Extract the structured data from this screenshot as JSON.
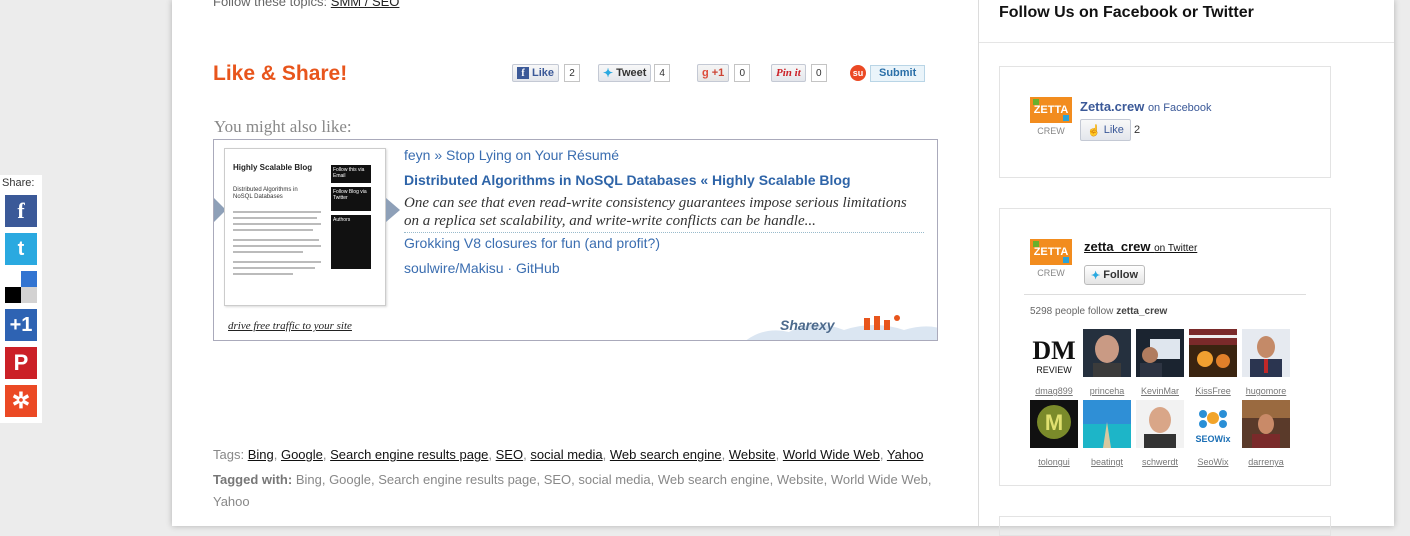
{
  "share_bar": {
    "label": "Share:",
    "buttons": [
      {
        "name": "facebook",
        "glyph": "f"
      },
      {
        "name": "twitter",
        "glyph": "t"
      },
      {
        "name": "delicious",
        "glyph": ""
      },
      {
        "name": "google-plus",
        "glyph": "+1"
      },
      {
        "name": "pinterest",
        "glyph": "P"
      },
      {
        "name": "stumbleupon",
        "glyph": "✲"
      }
    ]
  },
  "follow_topics": {
    "prefix": "Follow these topics:",
    "link": "SMM / SEO"
  },
  "like_share": {
    "title": "Like & Share!",
    "facebook": {
      "label": "Like",
      "count": "2"
    },
    "twitter": {
      "label": "Tweet",
      "count": "4"
    },
    "google": {
      "label": "+1",
      "count": "0"
    },
    "pinterest": {
      "label": "Pin it",
      "count": "0"
    },
    "stumble": {
      "label": "Submit"
    }
  },
  "related": {
    "heading": "You might also like:",
    "thumb": {
      "title": "Highly Scalable Blog",
      "subtitle": "Distributed Algorithms in NoSQL Databases",
      "side_1": "Follow this via Email",
      "side_2": "Follow Blog via Twitter",
      "side_3": "Authors"
    },
    "items": [
      {
        "text": "feyn » Stop Lying on Your Résumé"
      },
      {
        "text": "Distributed Algorithms in NoSQL Databases « Highly Scalable Blog"
      },
      {
        "text": "Grokking V8 closures for fun (and profit?)"
      },
      {
        "text": "soulwire/Makisu · GitHub"
      }
    ],
    "description": "One can see that even read-write consistency guarantees impose serious limitations on a replica set scalability, and write-write conflicts can be handle...",
    "drive_link": "drive free traffic to your site",
    "brand": "Sharexy"
  },
  "tags": {
    "prefix": "Tags:",
    "items": [
      "Bing",
      "Google",
      "Search engine results page",
      "SEO",
      "social media",
      "Web search engine",
      "Website",
      "World Wide Web",
      "Yahoo"
    ],
    "tagged_label": "Tagged with:",
    "tagged_text": "Bing, Google, Search engine results page, SEO, social media, Web search engine, Website, World Wide Web, Yahoo"
  },
  "sidebar": {
    "title": "Follow Us on Facebook or Twitter",
    "facebook": {
      "name": "Zetta.crew",
      "suffix": "on Facebook",
      "like_label": "Like",
      "count": "2"
    },
    "twitter": {
      "name": "zetta_crew",
      "suffix": "on Twitter",
      "follow_label": "Follow",
      "followers_prefix": "5298 people follow",
      "followers_handle": "zetta_crew",
      "followers": [
        {
          "name": "dmag899"
        },
        {
          "name": "princeha"
        },
        {
          "name": "KevinMar"
        },
        {
          "name": "KissFree"
        },
        {
          "name": "hugomore"
        },
        {
          "name": "tolongui"
        },
        {
          "name": "beatingt"
        },
        {
          "name": "schwerdt"
        },
        {
          "name": "SeoWix"
        },
        {
          "name": "darrenya"
        }
      ]
    },
    "logo_text_top": "ZETTA",
    "logo_text_bottom": "CREW"
  }
}
